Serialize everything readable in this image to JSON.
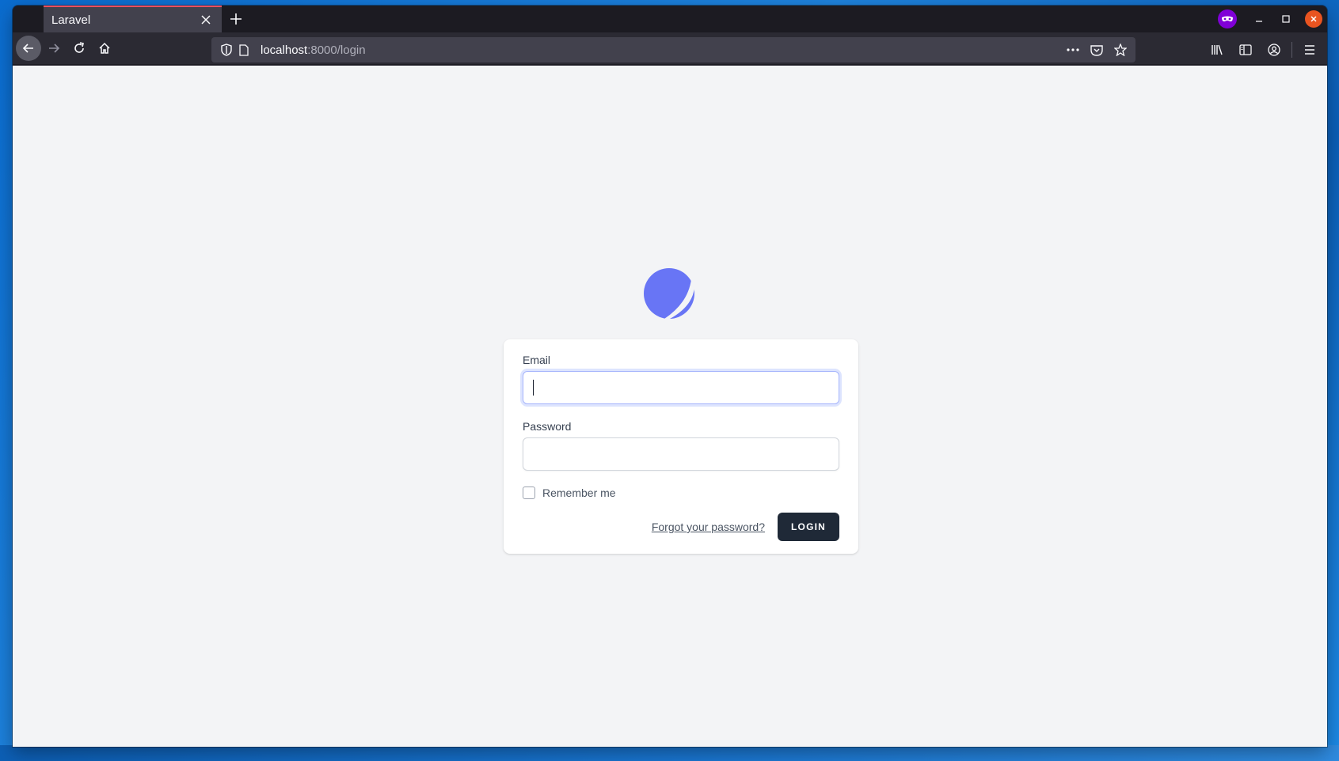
{
  "browser": {
    "tab_title": "Laravel",
    "tab_close_icon": "close-icon",
    "new_tab_icon": "plus-icon",
    "url_host": "localhost",
    "url_rest": ":8000/login",
    "window_controls": [
      "private-browsing-icon",
      "minimize-icon",
      "maximize-icon",
      "close-icon"
    ]
  },
  "nav": {
    "back_icon": "arrow-left-icon",
    "forward_icon": "arrow-right-icon",
    "reload_icon": "reload-icon",
    "home_icon": "home-icon"
  },
  "login": {
    "logo_icon": "breeze-logo-icon",
    "email_label": "Email",
    "email_value": "",
    "password_label": "Password",
    "password_value": "",
    "remember_label": "Remember me",
    "remember_checked": false,
    "forgot_link": "Forgot your password?",
    "login_button": "LOGIN"
  },
  "colors": {
    "accent": "#6875f5",
    "button_bg": "#1f2937",
    "page_bg": "#f3f4f6",
    "tab_highlight": "#ff4f5e",
    "private_badge": "#8000d7",
    "close_button": "#e95420"
  }
}
